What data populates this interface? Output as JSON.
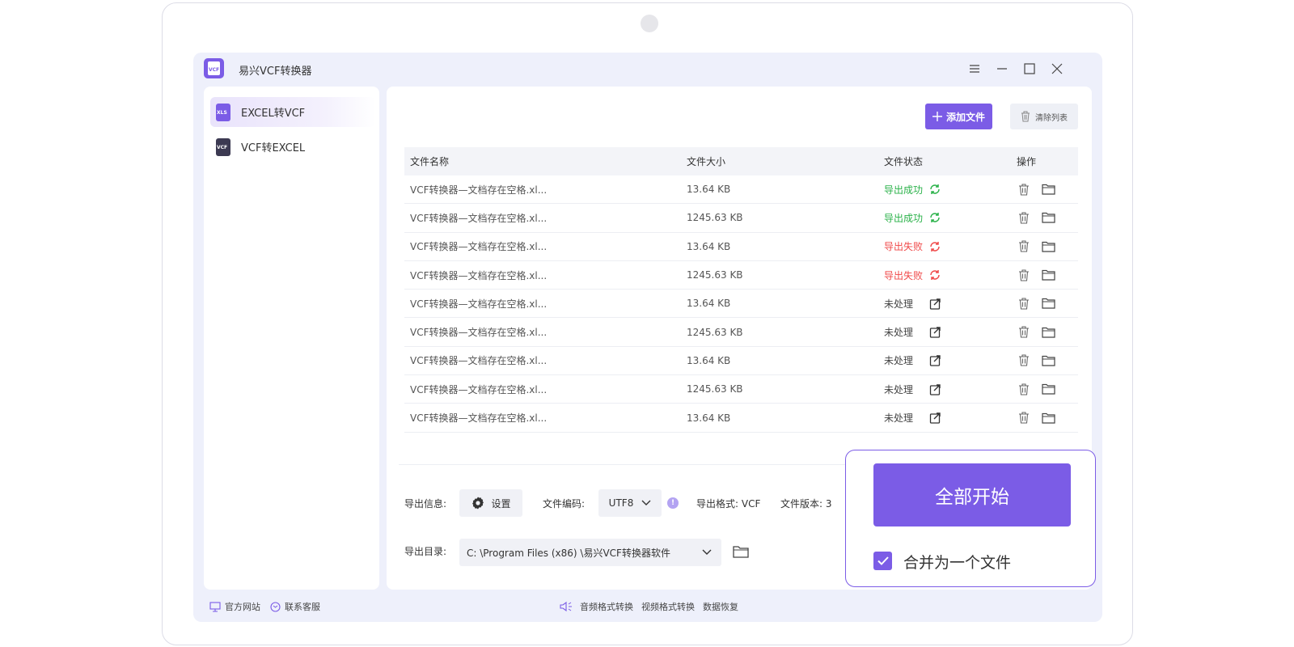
{
  "app": {
    "title": "易兴VCF转换器"
  },
  "sidebar": {
    "items": [
      {
        "label": "EXCEL转VCF",
        "icon": "xls-file-icon",
        "badge": "XLS",
        "color": "#7b5ce6",
        "active": true
      },
      {
        "label": "VCF转EXCEL",
        "icon": "vcf-file-icon",
        "badge": "VCF",
        "color": "#3c3a52",
        "active": false
      }
    ]
  },
  "toolbar": {
    "add_label": "添加文件",
    "clear_label": "清除列表"
  },
  "table": {
    "headers": [
      "文件名称",
      "文件大小",
      "文件状态",
      "操作"
    ],
    "rows": [
      {
        "name": "VCF转换器—文档存在空格.xl...",
        "size": "13.64  KB",
        "status": "导出成功",
        "state": "ok"
      },
      {
        "name": "VCF转换器—文档存在空格.xl...",
        "size": "1245.63  KB",
        "status": "导出成功",
        "state": "ok"
      },
      {
        "name": "VCF转换器—文档存在空格.xl...",
        "size": "13.64  KB",
        "status": "导出失败",
        "state": "fail"
      },
      {
        "name": "VCF转换器—文档存在空格.xl...",
        "size": "1245.63  KB",
        "status": "导出失败",
        "state": "fail"
      },
      {
        "name": "VCF转换器—文档存在空格.xl...",
        "size": "13.64  KB",
        "status": "未处理",
        "state": "none"
      },
      {
        "name": "VCF转换器—文档存在空格.xl...",
        "size": "1245.63  KB",
        "status": "未处理",
        "state": "none"
      },
      {
        "name": "VCF转换器—文档存在空格.xl...",
        "size": "13.64  KB",
        "status": "未处理",
        "state": "none"
      },
      {
        "name": "VCF转换器—文档存在空格.xl...",
        "size": "1245.63  KB",
        "status": "未处理",
        "state": "none"
      },
      {
        "name": "VCF转换器—文档存在空格.xl...",
        "size": "13.64  KB",
        "status": "未处理",
        "state": "none"
      }
    ]
  },
  "export": {
    "info_label": "导出信息:",
    "settings_label": "设置",
    "encoding_label": "文件编码:",
    "encoding_value": "UTF8",
    "format_text": "导出格式:  VCF",
    "version_text": "文件版本:  3",
    "dir_label": "导出目录:",
    "dir_value": "C: \\Program  Files (x86) \\易兴VCF转换器软件"
  },
  "start": {
    "label": "全部开始",
    "merge_label": "合并为一个文件",
    "merge_checked": true
  },
  "footer": {
    "website": "官方网站",
    "support": "联系客服",
    "links": [
      "音频格式转换",
      "视频格式转换",
      "数据恢复"
    ]
  },
  "colors": {
    "accent": "#7b5ce6",
    "success": "#2bb24a",
    "fail": "#f04a4a"
  }
}
